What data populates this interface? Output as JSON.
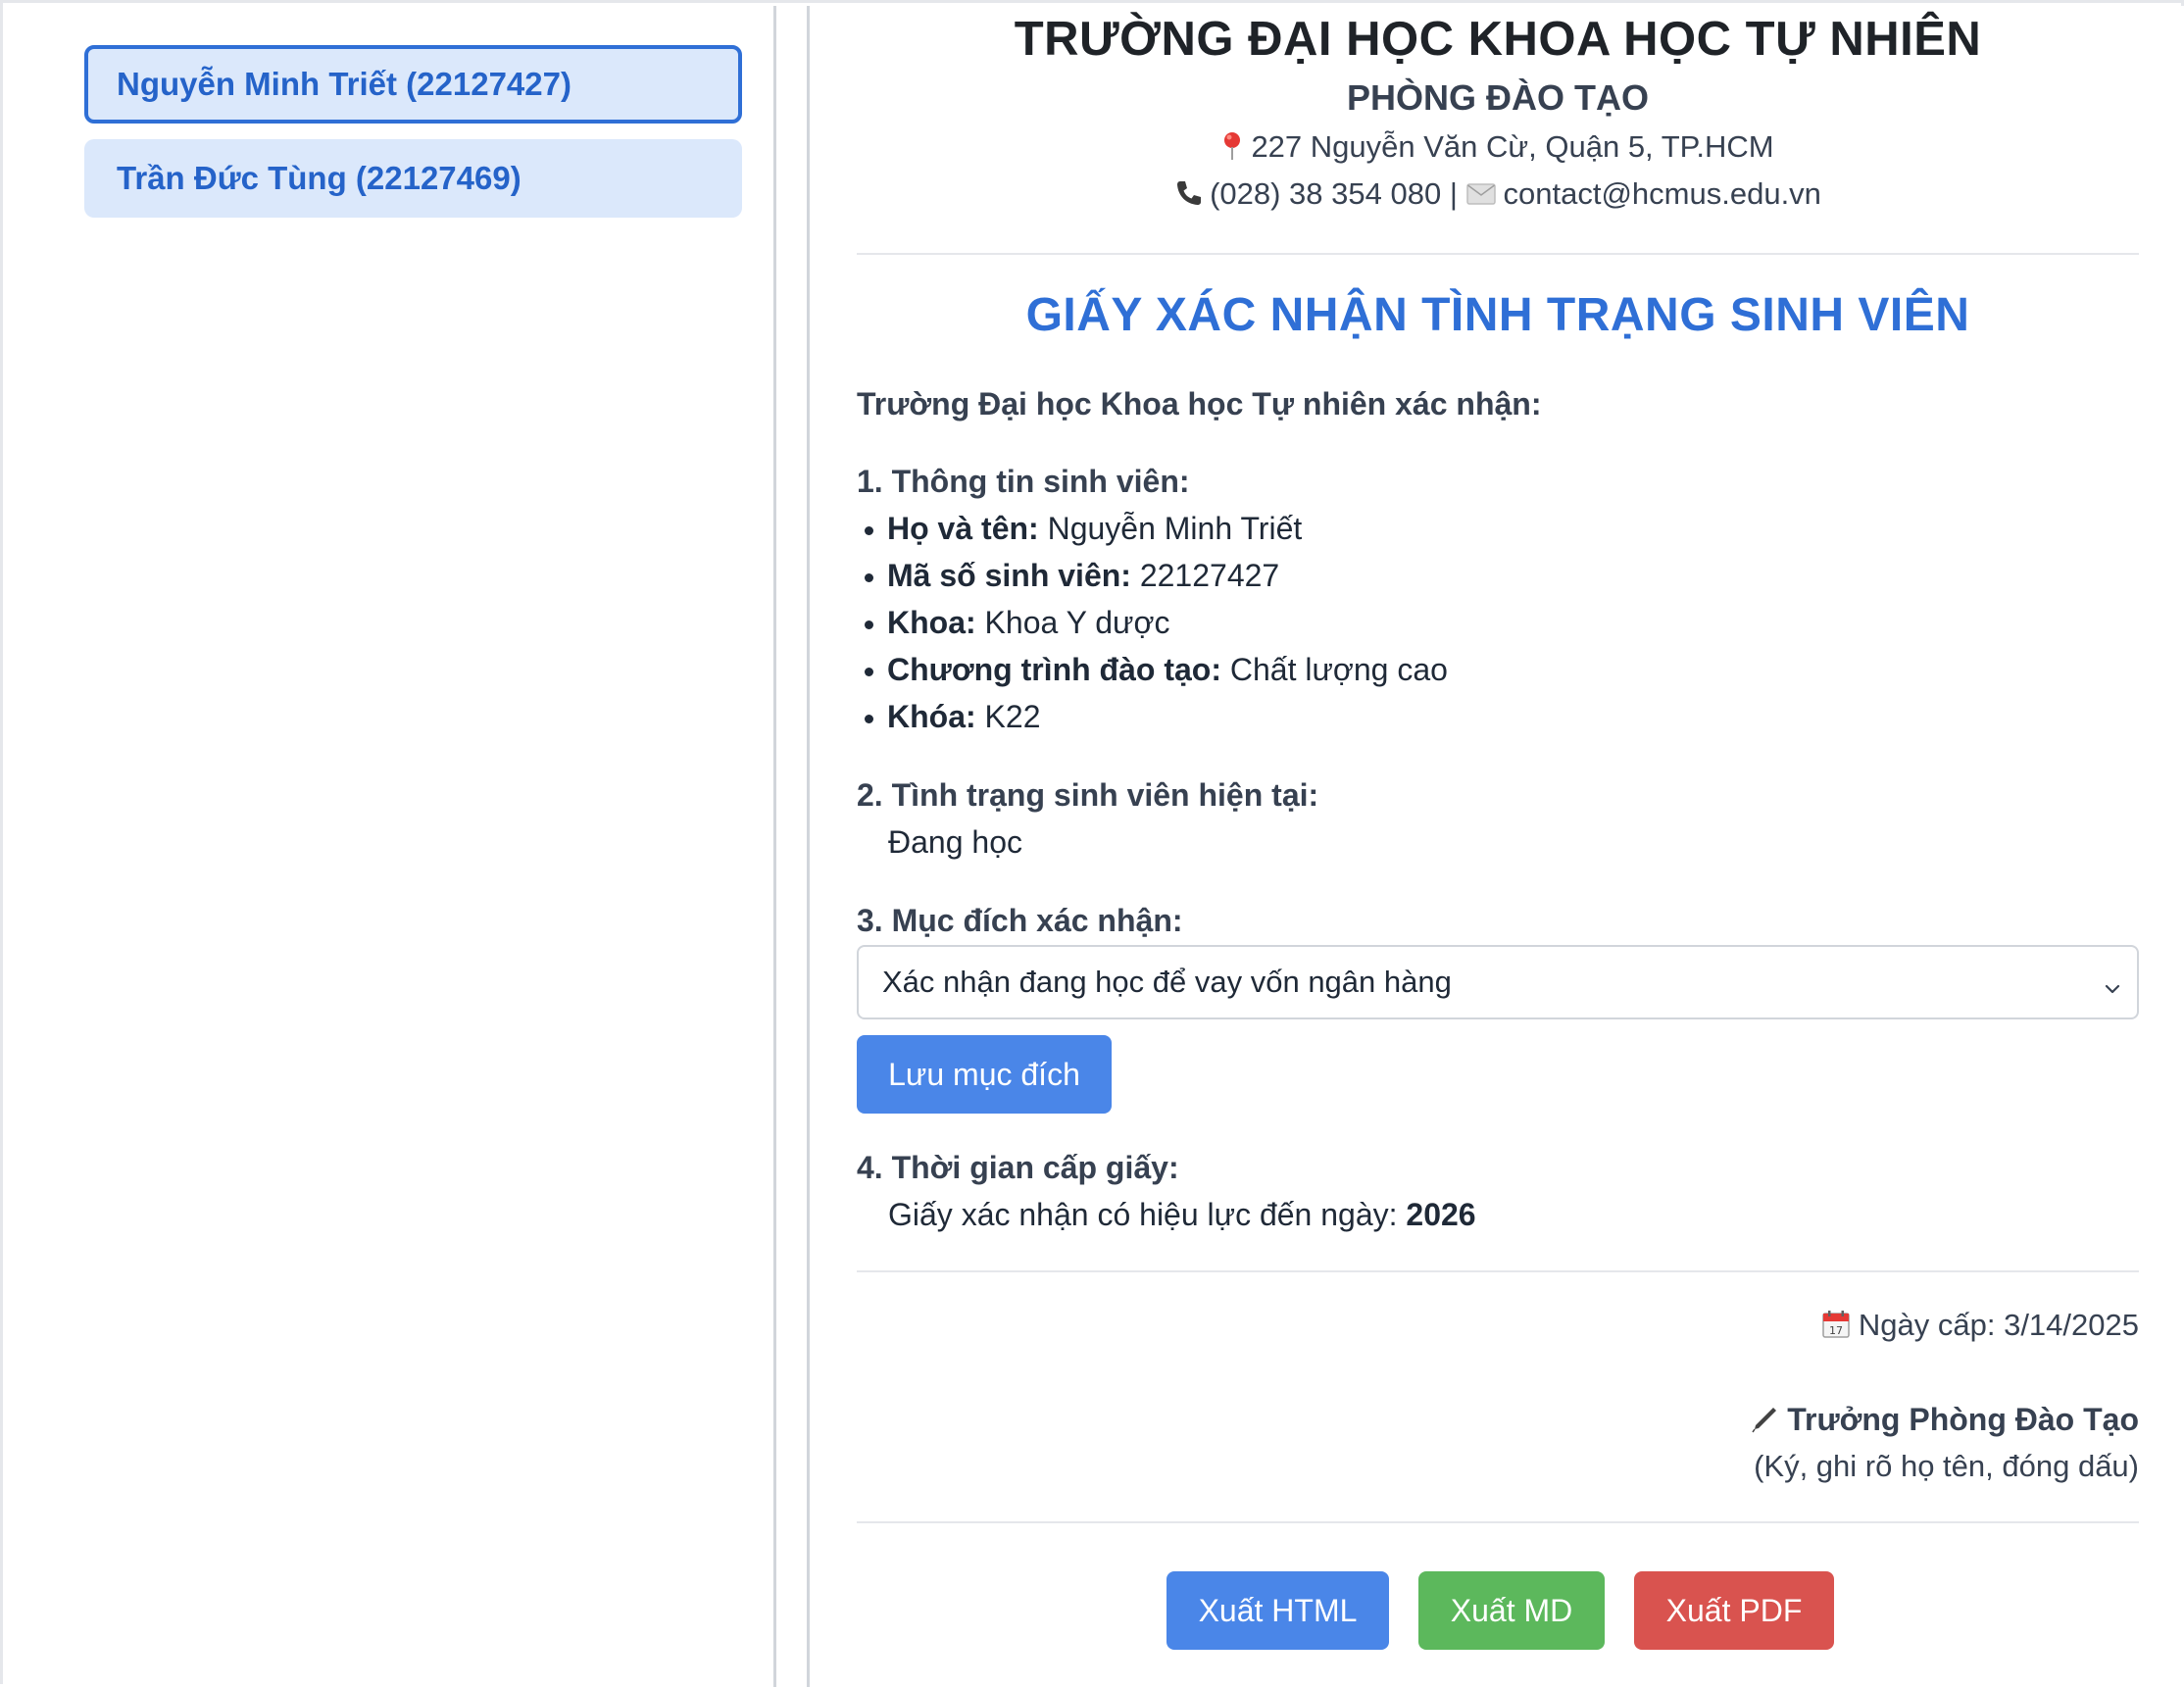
{
  "sidebar": {
    "students": [
      {
        "label": "Nguyễn Minh Triết (22127427)"
      },
      {
        "label": "Trần Đức Tùng (22127469)"
      }
    ]
  },
  "header": {
    "university": "TRƯỜNG ĐẠI HỌC KHOA HỌC TỰ NHIÊN",
    "department": "PHÒNG ĐÀO TẠO",
    "address": "227 Nguyễn Văn Cừ, Quận 5, TP.HCM",
    "phone": "(028) 38 354 080",
    "separator": "|",
    "email": "contact@hcmus.edu.vn"
  },
  "document": {
    "title": "GIẤY XÁC NHẬN TÌNH TRẠNG SINH VIÊN",
    "intro": "Trường Đại học Khoa học Tự nhiên xác nhận:",
    "section1": {
      "heading": "1. Thông tin sinh viên:",
      "items": [
        {
          "label": "Họ và tên:",
          "value": "Nguyễn Minh Triết"
        },
        {
          "label": "Mã số sinh viên:",
          "value": "22127427"
        },
        {
          "label": "Khoa:",
          "value": "Khoa Y dược"
        },
        {
          "label": "Chương trình đào tạo:",
          "value": "Chất lượng cao"
        },
        {
          "label": "Khóa:",
          "value": "K22"
        }
      ]
    },
    "section2": {
      "heading": "2. Tình trạng sinh viên hiện tại:",
      "value": "Đang học"
    },
    "section3": {
      "heading": "3. Mục đích xác nhận:",
      "selected_option": "Xác nhận đang học để vay vốn ngân hàng",
      "save_label": "Lưu mục đích"
    },
    "section4": {
      "heading": "4. Thời gian cấp giấy:",
      "validity_text": "Giấy xác nhận có hiệu lực đến ngày:",
      "validity_value": "2026"
    },
    "issue_date_label": "Ngày cấp:",
    "issue_date": "3/14/2025",
    "signer_title": "Trưởng Phòng Đào Tạo",
    "signer_note": "(Ký, ghi rõ họ tên, đóng dấu)"
  },
  "export": {
    "html_label": "Xuất HTML",
    "md_label": "Xuất MD",
    "pdf_label": "Xuất PDF"
  },
  "colors": {
    "accent": "#2f6fd6",
    "sidebar_item_bg": "#dbe8fb",
    "btn_blue": "#4a86e8",
    "btn_green": "#5cb85c",
    "btn_red": "#d9534f"
  },
  "icons": [
    "pin-icon",
    "phone-icon",
    "mail-icon",
    "chevron-down-icon",
    "calendar-icon",
    "pen-icon"
  ]
}
